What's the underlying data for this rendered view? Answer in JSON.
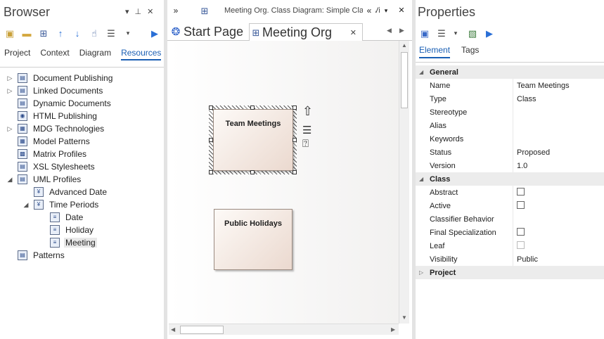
{
  "browser": {
    "title": "Browser",
    "nav": [
      "Project",
      "Context",
      "Diagram",
      "Resources"
    ],
    "tree": [
      {
        "label": "Document Publishing",
        "expander": "▷",
        "icon": "folder-doc-icon"
      },
      {
        "label": "Linked Documents",
        "expander": "▷",
        "icon": "folder-doc-icon"
      },
      {
        "label": "Dynamic Documents",
        "expander": "",
        "icon": "folder-doc-icon"
      },
      {
        "label": "HTML Publishing",
        "expander": "",
        "icon": "html-icon"
      },
      {
        "label": "MDG Technologies",
        "expander": "▷",
        "icon": "mdg-icon"
      },
      {
        "label": "Model Patterns",
        "expander": "",
        "icon": "pattern-icon"
      },
      {
        "label": "Matrix Profiles",
        "expander": "",
        "icon": "matrix-icon"
      },
      {
        "label": "XSL Stylesheets",
        "expander": "",
        "icon": "xsl-icon"
      },
      {
        "label": "UML Profiles",
        "expander": "◢",
        "icon": "profile-icon"
      },
      {
        "label": "Advanced Date",
        "expander": "",
        "icon": "stereotype-icon"
      },
      {
        "label": "Time Periods",
        "expander": "◢",
        "icon": "stereotype-icon"
      },
      {
        "label": "Date",
        "expander": "",
        "icon": "element-icon"
      },
      {
        "label": "Holiday",
        "expander": "",
        "icon": "element-icon"
      },
      {
        "label": "Meeting",
        "expander": "",
        "icon": "element-icon"
      },
      {
        "label": "Patterns",
        "expander": "",
        "icon": "patterns-icon"
      }
    ]
  },
  "diagram": {
    "header": "Meeting Org.  Class Diagram: Simple Class View",
    "tabs": [
      "Start Page",
      "Meeting Org"
    ],
    "elements": [
      "Team Meetings",
      "Public Holidays"
    ]
  },
  "properties": {
    "title": "Properties",
    "tabs": [
      "Element",
      "Tags"
    ],
    "categories": [
      "General",
      "Class",
      "Project"
    ],
    "general": [
      {
        "name": "Name",
        "value": "Team Meetings"
      },
      {
        "name": "Type",
        "value": "Class"
      },
      {
        "name": "Stereotype",
        "value": ""
      },
      {
        "name": "Alias",
        "value": ""
      },
      {
        "name": "Keywords",
        "value": ""
      },
      {
        "name": "Status",
        "value": "Proposed"
      },
      {
        "name": "Version",
        "value": "1.0"
      }
    ],
    "class": [
      {
        "name": "Abstract",
        "value": ""
      },
      {
        "name": "Active",
        "value": ""
      },
      {
        "name": "Classifier Behavior",
        "value": ""
      },
      {
        "name": "Final Specialization",
        "value": ""
      },
      {
        "name": "Leaf",
        "value": ""
      },
      {
        "name": "Visibility",
        "value": "Public"
      }
    ]
  },
  "colors": {
    "accent": "#1a5fb4",
    "element_fill": "#ebd9cf",
    "category_bg": "#ececec"
  }
}
